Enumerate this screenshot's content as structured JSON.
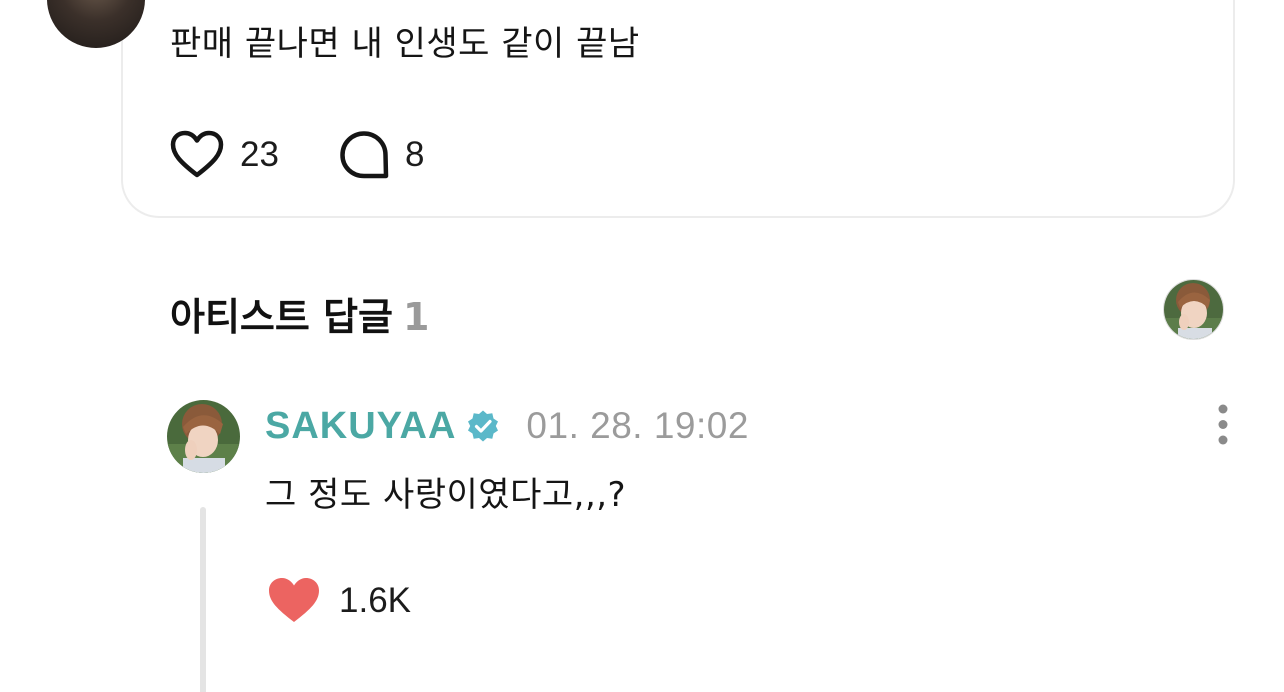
{
  "top_comment": {
    "text": "판매 끝나면 내 인생도 같이 끝남",
    "like_count": "23",
    "reply_count": "8"
  },
  "artist_section": {
    "title": "아티스트 답글",
    "count": "1"
  },
  "artist_reply": {
    "name": "SAKUYAA",
    "timestamp": "01. 28. 19:02",
    "text": "그 정도 사랑이였다고,,,?",
    "like_count": "1.6K",
    "liked": true
  },
  "colors": {
    "artist_name": "#4ba8a4",
    "verified_badge": "#5bb8c9",
    "heart_liked": "#ec6461",
    "muted_text": "#9b9b9b"
  },
  "icons": [
    "heart-outline-icon",
    "speech-bubble-icon",
    "verified-badge-icon",
    "heart-filled-icon",
    "more-vertical-icon"
  ]
}
